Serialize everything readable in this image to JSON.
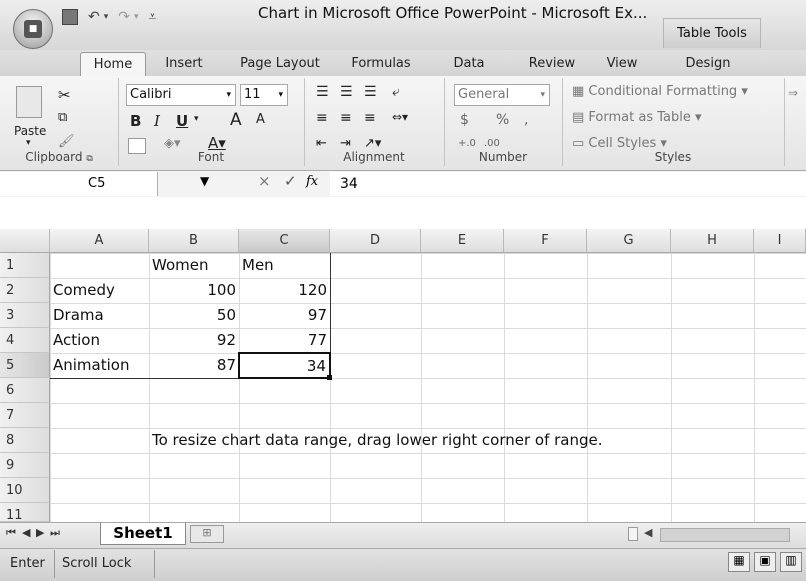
{
  "window": {
    "title": "Chart in Microsoft Office PowerPoint - Microsoft Ex...",
    "contextual_tab_group": "Table Tools"
  },
  "ribbon_tabs": [
    "Home",
    "Insert",
    "Page Layout",
    "Formulas",
    "Data",
    "Review",
    "View",
    "Design"
  ],
  "active_tab": "Home",
  "ribbon": {
    "clipboard": {
      "label": "Clipboard",
      "paste": "Paste"
    },
    "font": {
      "label": "Font",
      "name": "Calibri",
      "size": "11",
      "bold": "B",
      "italic": "I",
      "underline": "U",
      "grow": "A",
      "shrink": "A"
    },
    "alignment": {
      "label": "Alignment"
    },
    "number": {
      "label": "Number",
      "format": "General",
      "currency": "$",
      "percent": "%",
      "comma": ","
    },
    "styles": {
      "label": "Styles",
      "conditional": "Conditional Formatting",
      "format_table": "Format as Table",
      "cell_styles": "Cell Styles"
    }
  },
  "formula_bar": {
    "name_box": "C5",
    "fx": "fx",
    "value": "34"
  },
  "columns": [
    "A",
    "B",
    "C",
    "D",
    "E",
    "F",
    "G",
    "H",
    "I"
  ],
  "rows": [
    "1",
    "2",
    "3",
    "4",
    "5",
    "6",
    "7",
    "8",
    "9",
    "10",
    "11"
  ],
  "cells": {
    "B1": "Women",
    "C1": "Men",
    "A2": "Comedy",
    "B2": "100",
    "C2": "120",
    "A3": "Drama",
    "B3": "50",
    "C3": "97",
    "A4": "Action",
    "B4": "92",
    "C4": "77",
    "A5": "Animation",
    "B5": "87",
    "C5": "34",
    "B8": "To resize chart data range, drag lower right corner of range."
  },
  "sheet_tabs": [
    "Sheet1"
  ],
  "status": {
    "mode": "Enter",
    "scroll_lock": "Scroll Lock"
  }
}
